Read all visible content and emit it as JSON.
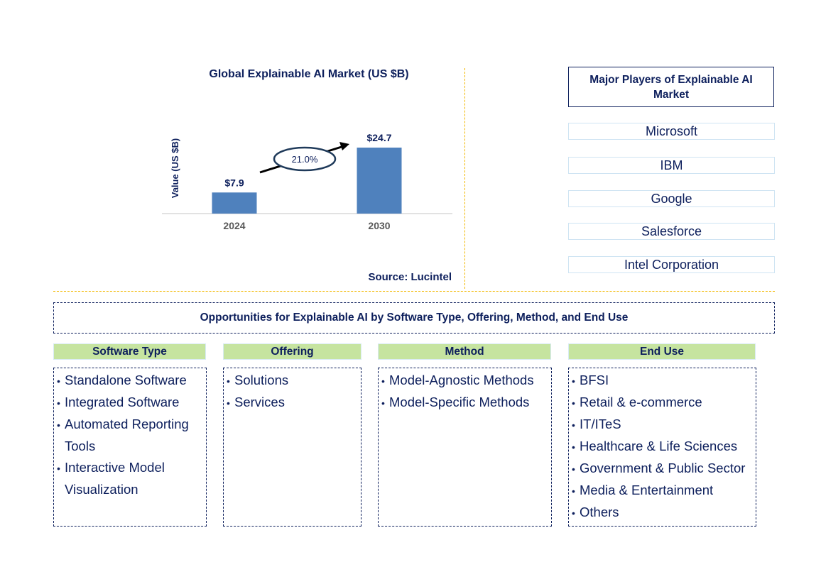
{
  "chart_data": {
    "type": "bar",
    "title": "Global Explainable AI Market (US $B)",
    "xlabel": "",
    "ylabel": "Value (US $B)",
    "categories": [
      "2024",
      "2030"
    ],
    "values": [
      7.9,
      24.7
    ],
    "data_labels": [
      "$7.9",
      "$24.7"
    ],
    "ylim": [
      0,
      24.7
    ],
    "grid": false,
    "bar_color": "#4f81bd",
    "annotation": {
      "text": "21.0%",
      "type": "growth-arrow-with-ellipse",
      "meaning": "CAGR 2024-2030"
    },
    "source": "Source: Lucintel"
  },
  "players": {
    "title": "Major Players of Explainable AI Market",
    "items": [
      "Microsoft",
      "IBM",
      "Google",
      "Salesforce",
      "Intel Corporation"
    ]
  },
  "opportunities": {
    "title": "Opportunities for Explainable AI by Software Type, Offering, Method, and End Use",
    "categories": [
      {
        "header": "Software Type",
        "items": [
          "Standalone Software",
          "Integrated Software",
          "Automated Reporting Tools",
          "Interactive Model Visualization"
        ]
      },
      {
        "header": "Offering",
        "items": [
          "Solutions",
          "Services"
        ]
      },
      {
        "header": "Method",
        "items": [
          "Model-Agnostic Methods",
          "Model-Specific Methods"
        ]
      },
      {
        "header": "End Use",
        "items": [
          "BFSI",
          "Retail & e-commerce",
          "IT/ITeS",
          "Healthcare & Life Sciences",
          "Government & Public Sector",
          "Media & Entertainment",
          "Others"
        ]
      }
    ]
  },
  "colors": {
    "text": "#0d1f5c",
    "bar": "#4f81bd",
    "divider": "#f2b800",
    "header_fill": "#c6e4a0",
    "player_border": "#cfe4f3"
  }
}
